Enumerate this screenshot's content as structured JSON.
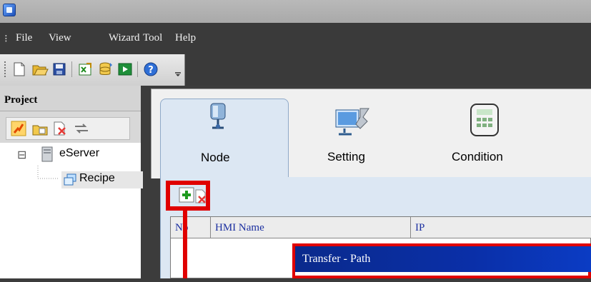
{
  "menu": {
    "grip": "⁝",
    "items": [
      "File",
      "View",
      "Wizard",
      "Tool",
      "Help"
    ]
  },
  "toolbar": {
    "buttons": [
      "new-file",
      "open-folder",
      "save",
      "import-excel",
      "database",
      "run",
      "help"
    ]
  },
  "project_panel": {
    "title": "Project",
    "tree": {
      "root": {
        "expander": "⊟",
        "label": "eServer"
      },
      "child": {
        "label": "Recipe"
      }
    }
  },
  "tabs": [
    {
      "label": "Node",
      "icon": "node-icon",
      "selected": true
    },
    {
      "label": "Setting",
      "icon": "setting-icon",
      "selected": false
    },
    {
      "label": "Condition",
      "icon": "condition-icon",
      "selected": false
    }
  ],
  "grid": {
    "columns": [
      "No",
      "HMI Name",
      "IP"
    ]
  },
  "dialog": {
    "title": "Transfer - Path"
  },
  "colors": {
    "highlight": "#e00000",
    "dialog_title": "#0a2fa8",
    "tab_selected": "#dce7f3"
  }
}
